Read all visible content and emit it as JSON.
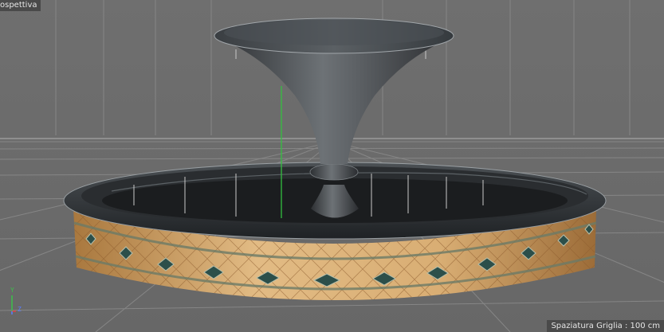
{
  "viewport": {
    "label": "ospettiva",
    "status": "Spaziatura Griglia : 100 cm"
  },
  "axis_gizmo": {
    "y_label": "Y",
    "z_label": "Z",
    "y_color": "#3cc04a",
    "z_color": "#5a7cff",
    "x_color": "#e04040"
  },
  "colors": {
    "background": "#6e6e6e",
    "grid_line": "#8a8a8a",
    "grid_line_strong": "#a3a3a3",
    "basin_rim": "#2f3336",
    "basin_water": "#1b1d1f",
    "tile_base": "#c99a5e",
    "tile_diamond": "#2c4f4a",
    "vase": "#4a4e52",
    "vertical_axis": "#33c040"
  }
}
